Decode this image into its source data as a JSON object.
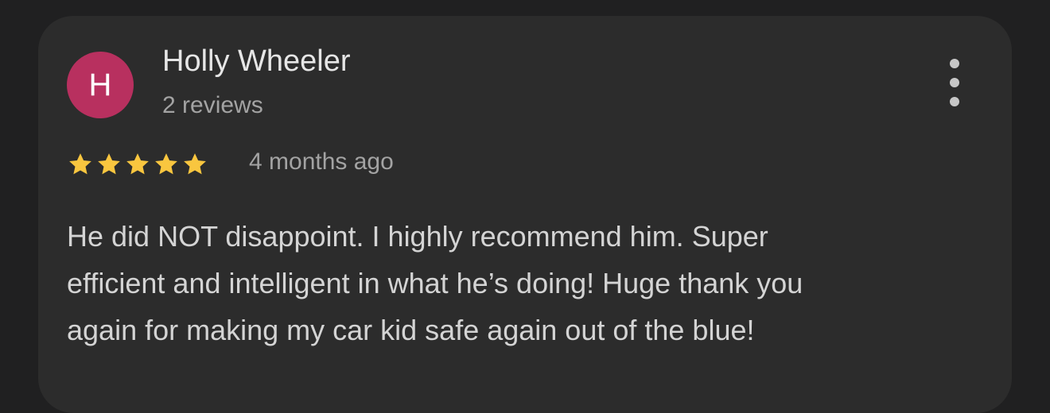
{
  "review": {
    "author": {
      "initial": "H",
      "name": "Holly Wheeler",
      "reviews_count": "2 reviews",
      "avatar_color": "#b8305f"
    },
    "rating": 5,
    "star_color": "#f9c63f",
    "time_ago": "4 months ago",
    "text_lines": [
      "He did NOT disappoint. I highly recommend him. Super",
      "efficient and intelligent in what he’s doing! Huge thank you",
      "again for making my car kid safe again out of the blue!"
    ],
    "more_icon": "more-vertical-icon"
  }
}
